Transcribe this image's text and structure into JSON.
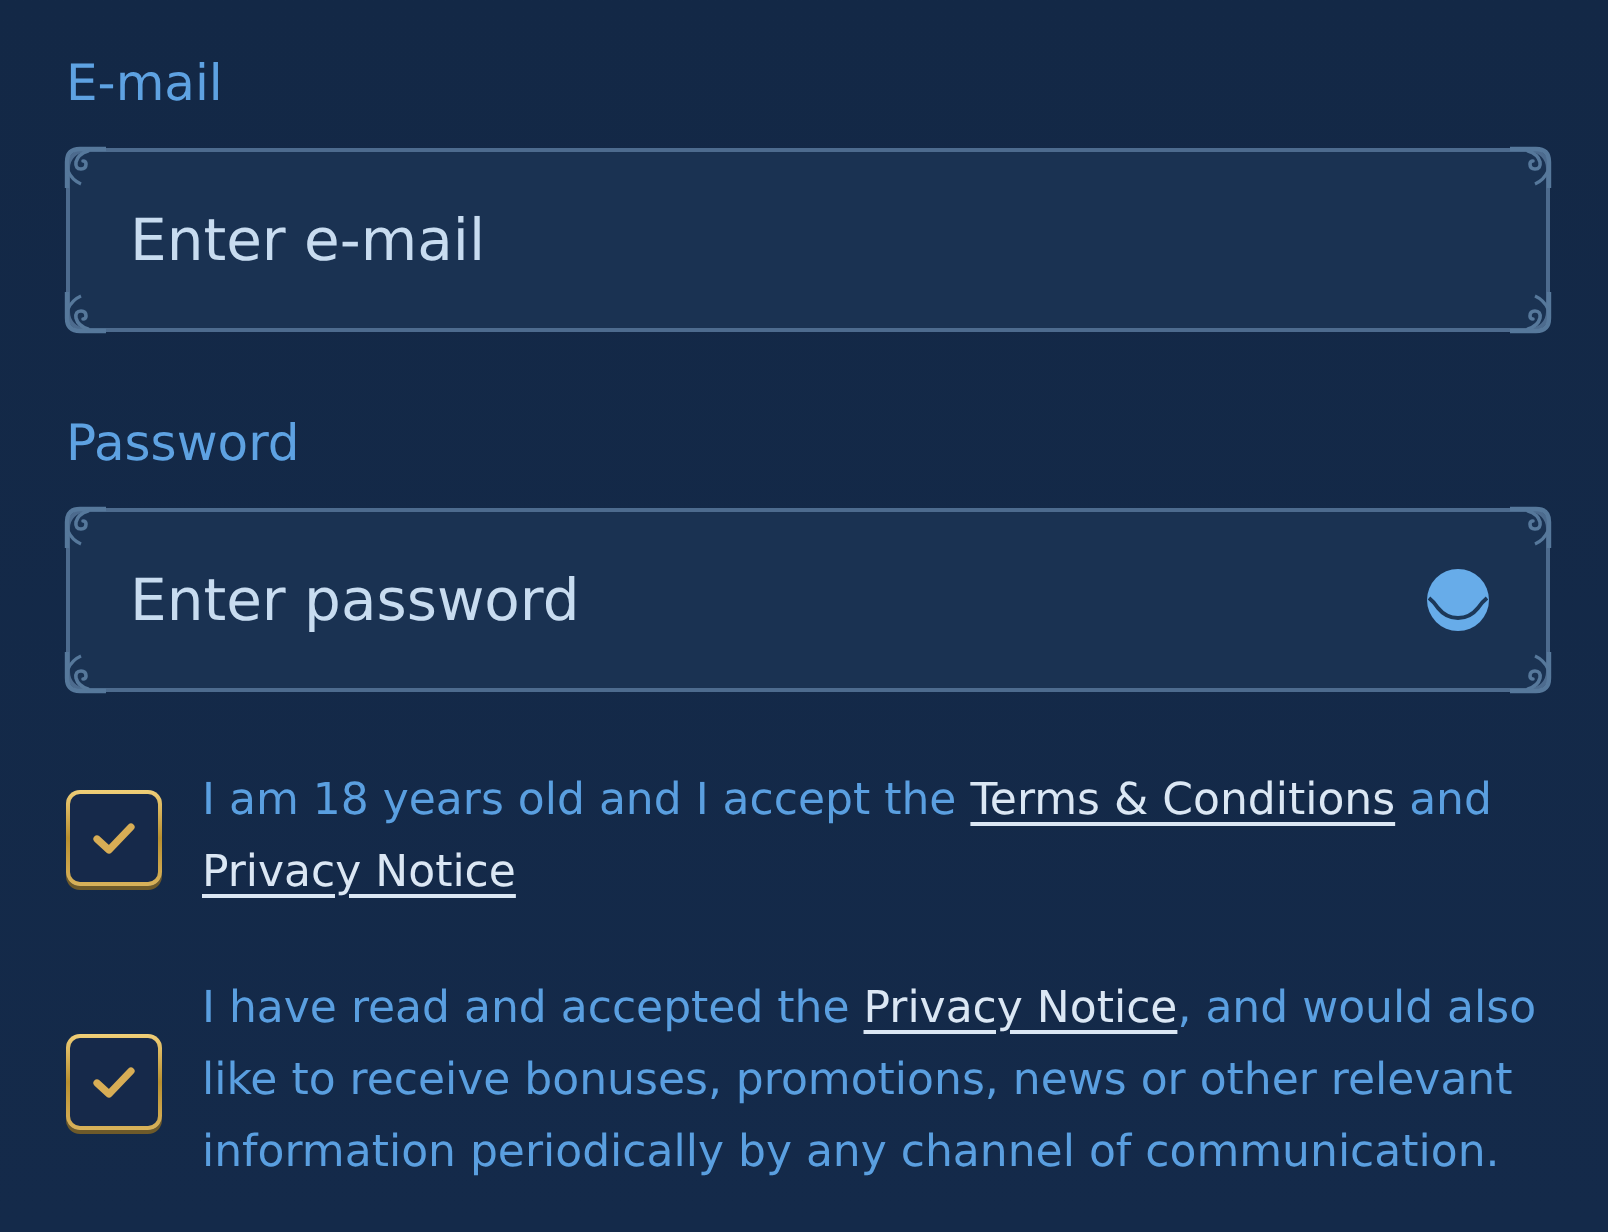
{
  "fields": [
    {
      "kind": "email",
      "label": "E-mail",
      "placeholder": "Enter e-mail"
    },
    {
      "kind": "password",
      "label": "Password",
      "placeholder": "Enter password"
    }
  ],
  "consents": [
    {
      "checked": true,
      "parts": [
        {
          "kind": "text",
          "text": "I am 18 years old and I accept the "
        },
        {
          "kind": "link",
          "text": "Terms & Conditions"
        },
        {
          "kind": "text",
          "text": " and "
        },
        {
          "kind": "link",
          "text": "Privacy Notice"
        }
      ]
    },
    {
      "checked": true,
      "parts": [
        {
          "kind": "text",
          "text": "I have read and accepted the "
        },
        {
          "kind": "link",
          "text": "Privacy Notice"
        },
        {
          "kind": "text",
          "text": ", and would also like to receive bonuses, promotions, news or other relevant information periodically by any channel of communication."
        }
      ]
    }
  ]
}
